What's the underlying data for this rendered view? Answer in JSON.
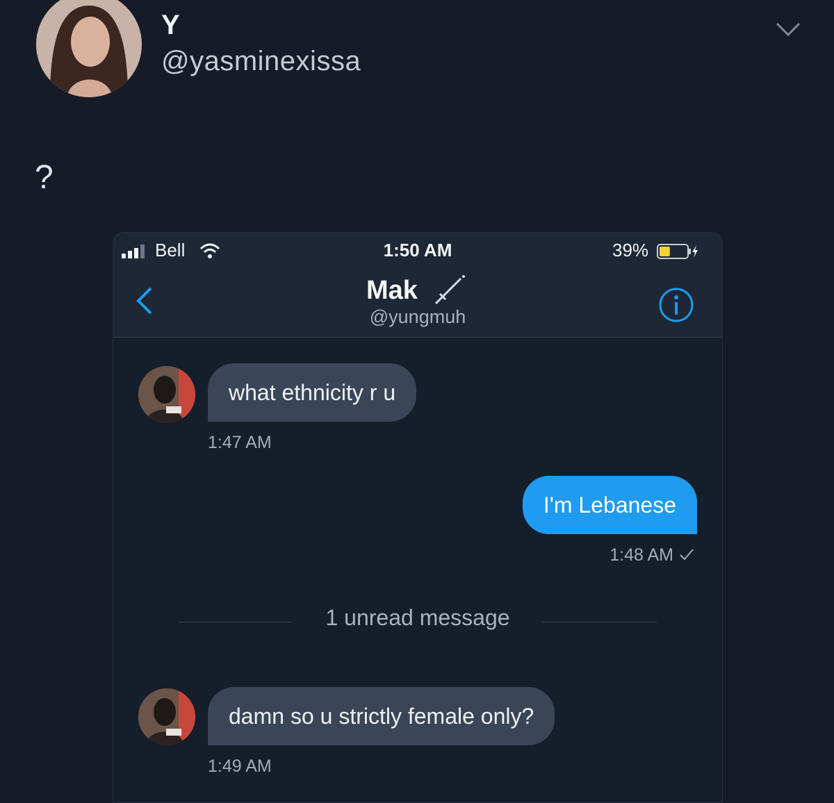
{
  "tweet": {
    "author_name": "Y",
    "author_handle": "@yasminexissa",
    "text": "?"
  },
  "dm": {
    "status_bar": {
      "carrier": "Bell",
      "time": "1:50 AM",
      "battery_percent": "39%",
      "battery_level": 0.39
    },
    "header": {
      "name": "Mak",
      "handle": "@yungmuh"
    },
    "messages": [
      {
        "direction": "incoming",
        "text": "what ethnicity r u",
        "time": "1:47 AM"
      },
      {
        "direction": "outgoing",
        "text": "I'm Lebanese",
        "time": "1:48 AM",
        "status": "sent"
      },
      {
        "direction": "incoming",
        "text": "damn so u strictly female only?",
        "time": "1:49 AM"
      }
    ],
    "unread_divider": "1 unread message"
  },
  "icons": [
    "chevron-down-icon",
    "signal-icon",
    "wifi-icon",
    "battery-icon",
    "charging-icon",
    "back-chevron-icon",
    "knife-icon",
    "info-icon",
    "checkmark-icon"
  ],
  "colors": {
    "background": "#151b27",
    "incoming_bubble": "#3a4657",
    "outgoing_bubble": "#1f9bf0",
    "accent": "#1d9bf0",
    "battery_fill": "#f3d23a"
  }
}
